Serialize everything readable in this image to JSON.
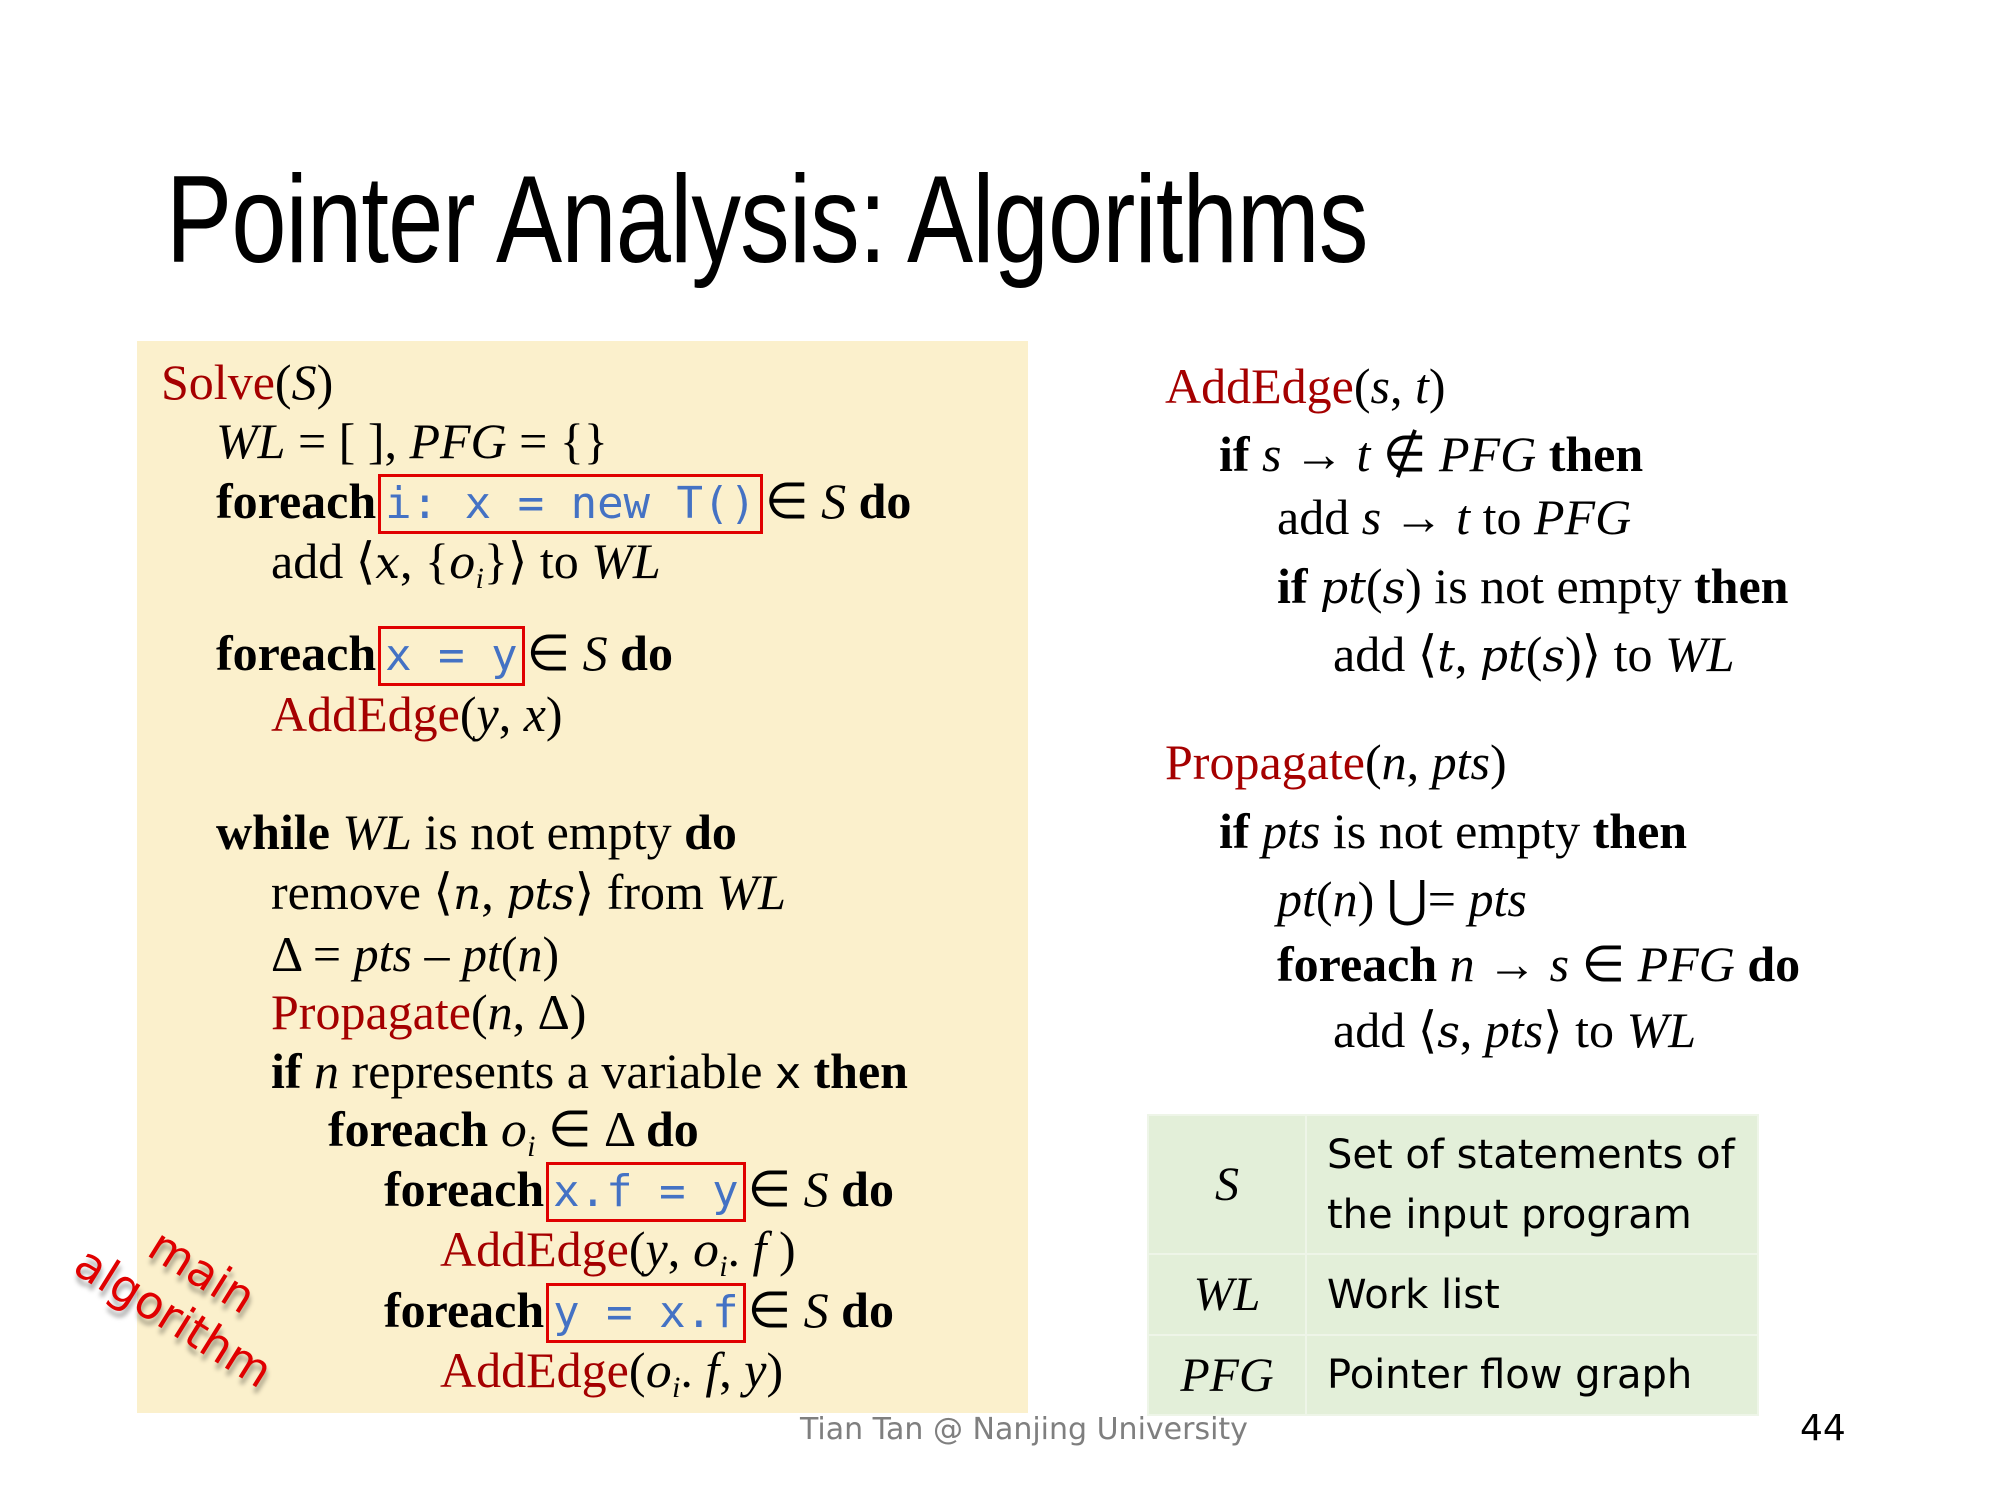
{
  "title": "Pointer Analysis: Algorithms",
  "main_algorithm": {
    "label_line1": "main",
    "label_line2": "algorithm",
    "lines": [
      {
        "indent": 0,
        "segs": [
          [
            "fn",
            "Solve"
          ],
          [
            "plain",
            "("
          ],
          [
            "it",
            "S"
          ],
          [
            "plain",
            ")"
          ]
        ]
      },
      {
        "indent": 1,
        "segs": [
          [
            "it",
            "WL"
          ],
          [
            "plain",
            " = [ ], "
          ],
          [
            "it",
            "PFG"
          ],
          [
            "plain",
            " = {}"
          ]
        ]
      },
      {
        "indent": 1,
        "segs": [
          [
            "kw",
            "foreach"
          ],
          [
            "code",
            "i: x = new T()"
          ],
          [
            "plain",
            "∈ "
          ],
          [
            "it",
            "S"
          ],
          [
            "kw",
            " do"
          ]
        ]
      },
      {
        "indent": 2,
        "segs": [
          [
            "plain",
            "add ⟨"
          ],
          [
            "math",
            "x"
          ],
          [
            "plain",
            ", {"
          ],
          [
            "math",
            "o"
          ],
          [
            "sub",
            "i"
          ],
          [
            "plain",
            "}⟩ to "
          ],
          [
            "it",
            "WL"
          ]
        ]
      },
      {
        "indent": 1,
        "segs": [
          [
            "kw",
            "foreach"
          ],
          [
            "code",
            "x = y"
          ],
          [
            "plain",
            "∈ "
          ],
          [
            "it",
            "S"
          ],
          [
            "kw",
            " do"
          ]
        ]
      },
      {
        "indent": 2,
        "segs": [
          [
            "fn",
            "AddEdge"
          ],
          [
            "plain",
            "("
          ],
          [
            "it",
            "y"
          ],
          [
            "plain",
            ", "
          ],
          [
            "it",
            "x"
          ],
          [
            "plain",
            ")"
          ]
        ]
      },
      {
        "indent": 1,
        "segs": [
          [
            "kw",
            "while"
          ],
          [
            "plain",
            " "
          ],
          [
            "it",
            "WL"
          ],
          [
            "plain",
            " is not empty "
          ],
          [
            "kw",
            "do"
          ]
        ]
      },
      {
        "indent": 2,
        "segs": [
          [
            "plain",
            "remove ⟨"
          ],
          [
            "math",
            "n"
          ],
          [
            "plain",
            ", "
          ],
          [
            "math",
            "pts"
          ],
          [
            "plain",
            "⟩ from "
          ],
          [
            "it",
            "WL"
          ]
        ]
      },
      {
        "indent": 2,
        "segs": [
          [
            "plain",
            "Δ = "
          ],
          [
            "it",
            "pts"
          ],
          [
            "plain",
            " – "
          ],
          [
            "it",
            "pt"
          ],
          [
            "plain",
            "("
          ],
          [
            "it",
            "n"
          ],
          [
            "plain",
            ")"
          ]
        ]
      },
      {
        "indent": 2,
        "segs": [
          [
            "fn",
            "Propagate"
          ],
          [
            "plain",
            "("
          ],
          [
            "it",
            "n"
          ],
          [
            "plain",
            ", Δ)"
          ]
        ]
      },
      {
        "indent": 2,
        "segs": [
          [
            "kw",
            "if"
          ],
          [
            "plain",
            " "
          ],
          [
            "it",
            "n"
          ],
          [
            "plain",
            " represents a variable "
          ],
          [
            "sansx",
            "x"
          ],
          [
            "kw",
            " then"
          ]
        ]
      },
      {
        "indent": 3,
        "segs": [
          [
            "kw",
            "foreach"
          ],
          [
            "plain",
            " "
          ],
          [
            "math",
            "o"
          ],
          [
            "sub",
            "i"
          ],
          [
            "plain",
            " ∈ Δ "
          ],
          [
            "kw",
            "do"
          ]
        ]
      },
      {
        "indent": 4,
        "segs": [
          [
            "kw",
            "foreach"
          ],
          [
            "code",
            "x.f = y"
          ],
          [
            "plain",
            "∈ "
          ],
          [
            "it",
            "S"
          ],
          [
            "kw",
            " do"
          ]
        ]
      },
      {
        "indent": 5,
        "segs": [
          [
            "fn",
            "AddEdge"
          ],
          [
            "plain",
            "("
          ],
          [
            "it",
            "y"
          ],
          [
            "plain",
            ", "
          ],
          [
            "math",
            "o"
          ],
          [
            "sub",
            "i"
          ],
          [
            "plain",
            "."
          ],
          [
            "it",
            " f"
          ],
          [
            "plain",
            " )"
          ]
        ]
      },
      {
        "indent": 4,
        "segs": [
          [
            "kw",
            "foreach"
          ],
          [
            "code",
            "y = x.f"
          ],
          [
            "plain",
            "∈ "
          ],
          [
            "it",
            "S"
          ],
          [
            "kw",
            " do"
          ]
        ]
      },
      {
        "indent": 5,
        "segs": [
          [
            "fn",
            "AddEdge"
          ],
          [
            "plain",
            "("
          ],
          [
            "math",
            "o"
          ],
          [
            "sub",
            "i"
          ],
          [
            "plain",
            "."
          ],
          [
            "it",
            " f"
          ],
          [
            "plain",
            ", "
          ],
          [
            "it",
            "y"
          ],
          [
            "plain",
            ")"
          ]
        ]
      }
    ]
  },
  "add_edge": {
    "lines": [
      {
        "indent": 0,
        "segs": [
          [
            "fn",
            "AddEdge"
          ],
          [
            "plain",
            "("
          ],
          [
            "it",
            "s"
          ],
          [
            "plain",
            ", "
          ],
          [
            "it",
            "t"
          ],
          [
            "plain",
            ")"
          ]
        ]
      },
      {
        "indent": 1,
        "segs": [
          [
            "kw",
            "if"
          ],
          [
            "plain",
            " "
          ],
          [
            "it",
            "s"
          ],
          [
            "plain",
            " → "
          ],
          [
            "it",
            "t"
          ],
          [
            "plain",
            " ∉ "
          ],
          [
            "it",
            "PFG"
          ],
          [
            "kw",
            " then"
          ]
        ]
      },
      {
        "indent": 2,
        "segs": [
          [
            "plain",
            "add "
          ],
          [
            "it",
            "s"
          ],
          [
            "plain",
            " → "
          ],
          [
            "it",
            "t"
          ],
          [
            "plain",
            " to "
          ],
          [
            "it",
            "PFG"
          ]
        ]
      },
      {
        "indent": 2,
        "segs": [
          [
            "kw",
            "if"
          ],
          [
            "plain",
            " "
          ],
          [
            "math",
            "pt"
          ],
          [
            "plain",
            "("
          ],
          [
            "math",
            "s"
          ],
          [
            "plain",
            ") is not empty "
          ],
          [
            "kw",
            "then"
          ]
        ]
      },
      {
        "indent": 3,
        "segs": [
          [
            "plain",
            "add ⟨"
          ],
          [
            "math",
            "t"
          ],
          [
            "plain",
            ", "
          ],
          [
            "math",
            "pt"
          ],
          [
            "plain",
            "("
          ],
          [
            "math",
            "s"
          ],
          [
            "plain",
            ")⟩ to "
          ],
          [
            "it",
            "WL"
          ]
        ]
      }
    ]
  },
  "propagate": {
    "lines": [
      {
        "indent": 0,
        "segs": [
          [
            "fn",
            "Propagate"
          ],
          [
            "plain",
            "("
          ],
          [
            "it",
            "n"
          ],
          [
            "plain",
            ", "
          ],
          [
            "it",
            "pts"
          ],
          [
            "plain",
            ")"
          ]
        ]
      },
      {
        "indent": 1,
        "segs": [
          [
            "kw",
            "if"
          ],
          [
            "plain",
            " "
          ],
          [
            "it",
            "pts"
          ],
          [
            "plain",
            " is not empty "
          ],
          [
            "kw",
            "then"
          ]
        ]
      },
      {
        "indent": 2,
        "segs": [
          [
            "it",
            "pt"
          ],
          [
            "plain",
            "("
          ],
          [
            "it",
            "n"
          ],
          [
            "plain",
            ") ⋃= "
          ],
          [
            "it",
            "pts"
          ]
        ]
      },
      {
        "indent": 2,
        "segs": [
          [
            "kw",
            "foreach"
          ],
          [
            "plain",
            " "
          ],
          [
            "it",
            "n"
          ],
          [
            "plain",
            " → "
          ],
          [
            "it",
            "s"
          ],
          [
            "plain",
            " ∈ "
          ],
          [
            "it",
            "PFG"
          ],
          [
            "kw",
            " do"
          ]
        ]
      },
      {
        "indent": 3,
        "segs": [
          [
            "plain",
            "add ⟨"
          ],
          [
            "math",
            "s"
          ],
          [
            "plain",
            ", "
          ],
          [
            "it",
            "pts"
          ],
          [
            "plain",
            "⟩ to "
          ],
          [
            "it",
            "WL"
          ]
        ]
      }
    ]
  },
  "legend": {
    "rows": [
      {
        "symbol": "S",
        "desc_line1": "Set of statements of",
        "desc_line2": "the input program"
      },
      {
        "symbol": "WL",
        "desc_line1": "Work list",
        "desc_line2": ""
      },
      {
        "symbol": "PFG",
        "desc_line1": "Pointer flow graph",
        "desc_line2": ""
      }
    ]
  },
  "footer": "Tian Tan @ Nanjing University",
  "page_number": "44",
  "colors": {
    "function_name": "#a50000",
    "code": "#4472c4",
    "highlight_box": "#e00000",
    "algo_background": "#fbf0cc",
    "legend_background": "#e3efd9"
  }
}
